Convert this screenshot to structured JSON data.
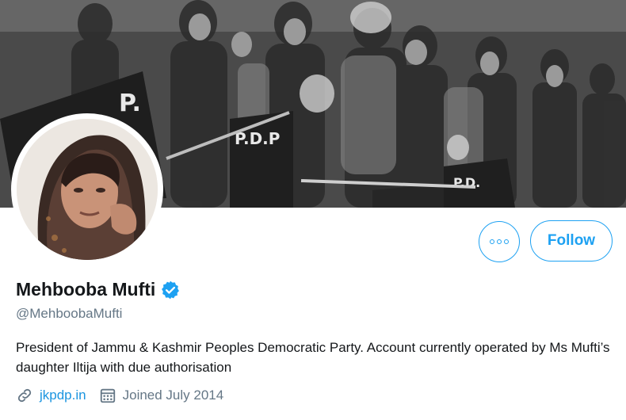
{
  "profile": {
    "name": "Mehbooba Mufti",
    "handle": "@MehboobaMufti",
    "bio": "President of Jammu & Kashmir Peoples Democratic Party. Account currently operated by Ms Mufti’s daughter Iltija with due authorisation",
    "website": "jkpdp.in",
    "joined": "Joined July 2014",
    "verified": true
  },
  "actions": {
    "follow_label": "Follow",
    "more_icon": "more-dots-icon"
  },
  "icons": {
    "verified": "verified-badge-icon",
    "link": "link-icon",
    "calendar": "calendar-icon"
  },
  "colors": {
    "accent": "#1da1f2",
    "link": "#1b95e0",
    "secondary_text": "#657786",
    "primary_text": "#14171a"
  }
}
